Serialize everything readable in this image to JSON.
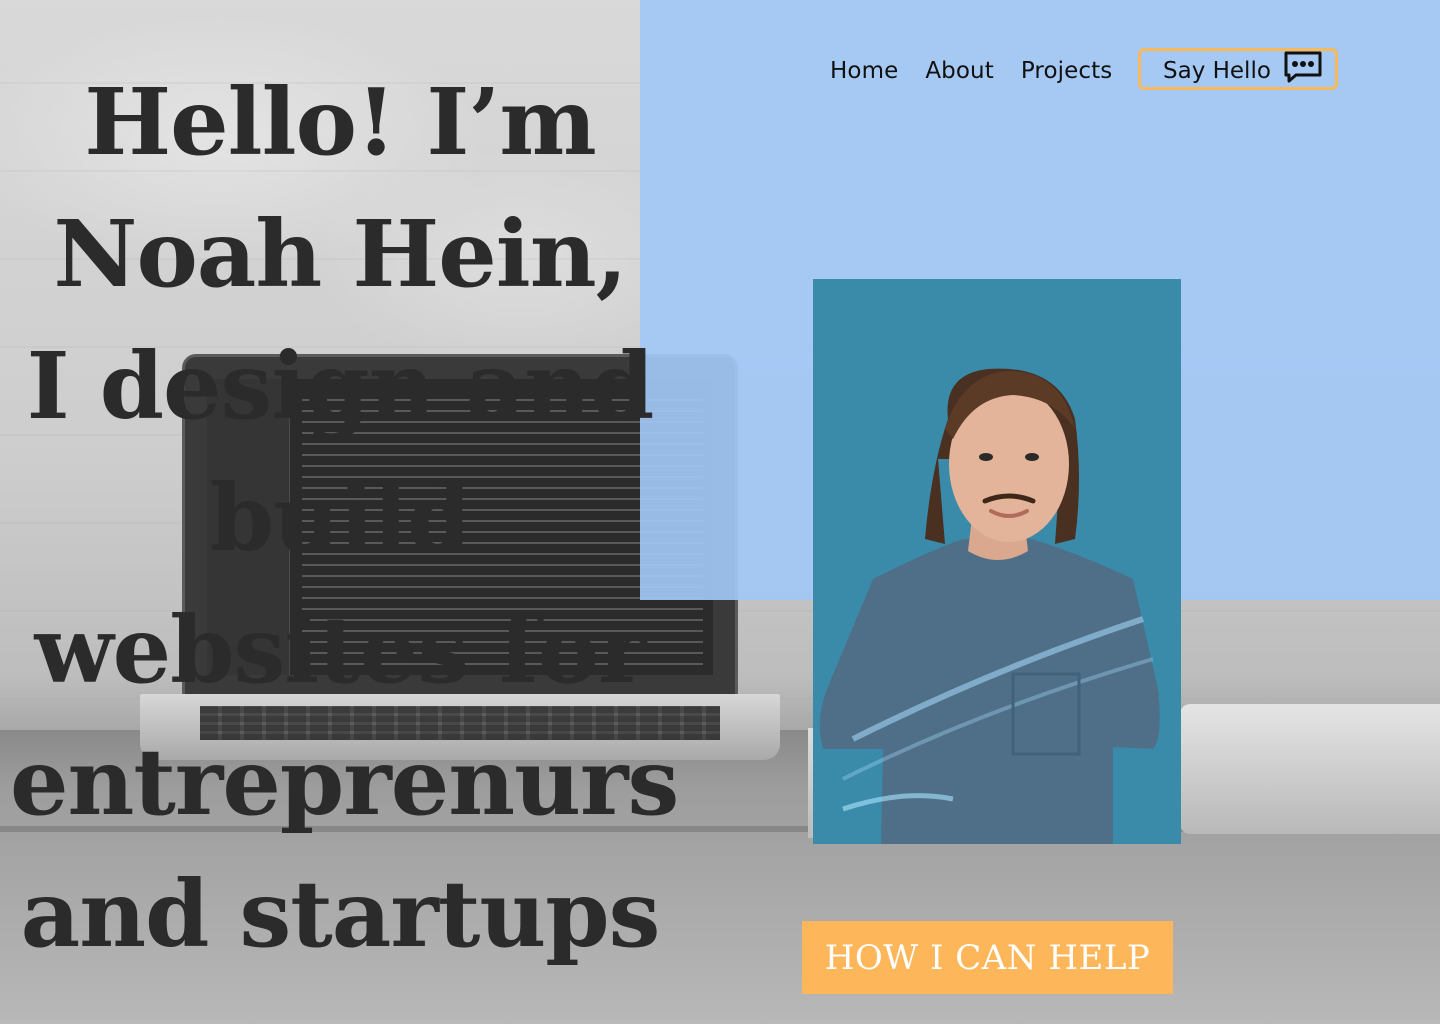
{
  "nav": {
    "items": [
      {
        "label": "Home"
      },
      {
        "label": "About"
      },
      {
        "label": "Projects"
      }
    ],
    "say_hello": {
      "label": "Say Hello",
      "icon": "chat-bubble-icon"
    }
  },
  "hero": {
    "lines": [
      "Hello! I’m",
      "Noah Hein,",
      "I design and",
      "build",
      "websites for",
      "entreprenurs",
      "and startups"
    ]
  },
  "portrait": {
    "icon": "profile-photo"
  },
  "cta": {
    "label": "HOW I CAN HELP"
  },
  "colors": {
    "blue_panel": "#a2c8f6",
    "accent": "#fdb75a",
    "portrait_bg": "#3a8aaa",
    "heading_text": "#2b2b2b"
  }
}
